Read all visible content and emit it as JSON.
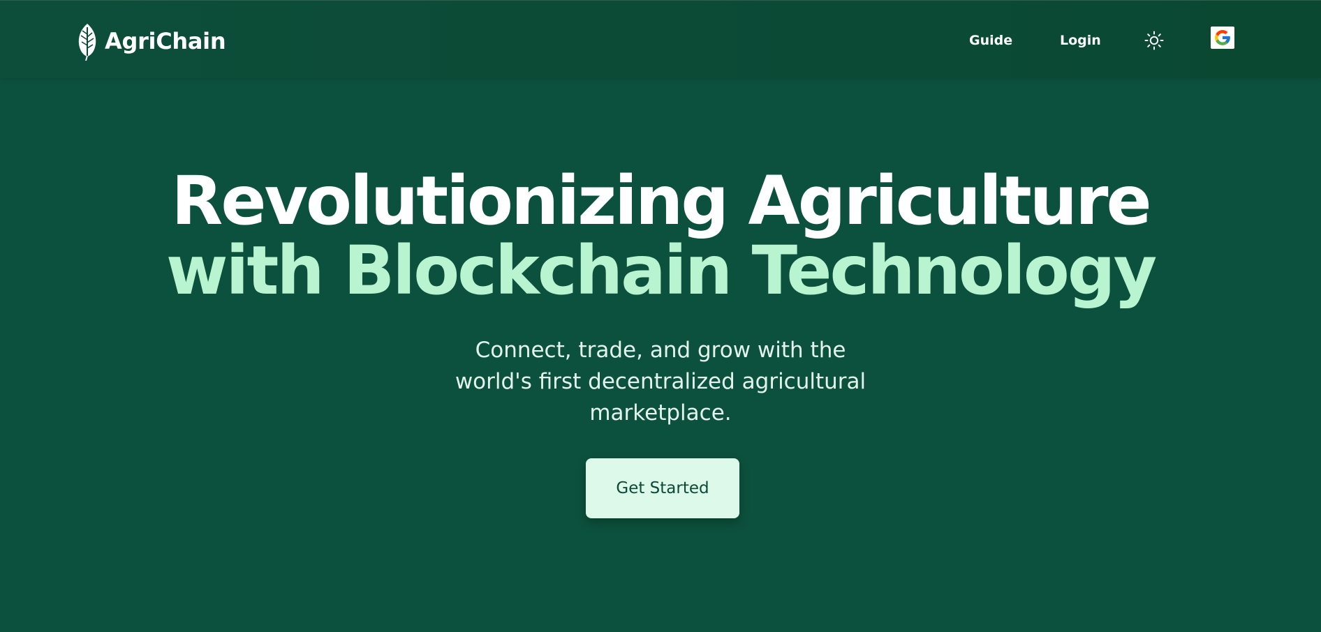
{
  "colors": {
    "background": "#0c513d",
    "navbar": "#0a4832",
    "headline_primary": "#ffffff",
    "headline_accent": "#b7f4cf",
    "cta_background": "#dcf9ea",
    "cta_text": "#0b4a36"
  },
  "navbar": {
    "brand": {
      "icon": "leaf-icon",
      "name": "AgriChain"
    },
    "links": [
      {
        "label": "Guide"
      },
      {
        "label": "Login"
      }
    ],
    "theme_toggle_icon": "sun-icon",
    "google_icon": "google-icon"
  },
  "hero": {
    "title_line1": "Revolutionizing Agriculture",
    "title_line2": "with Blockchain Technology",
    "subtitle": "Connect, trade, and grow with the world's first decentralized agricultural marketplace.",
    "cta_label": "Get Started"
  }
}
